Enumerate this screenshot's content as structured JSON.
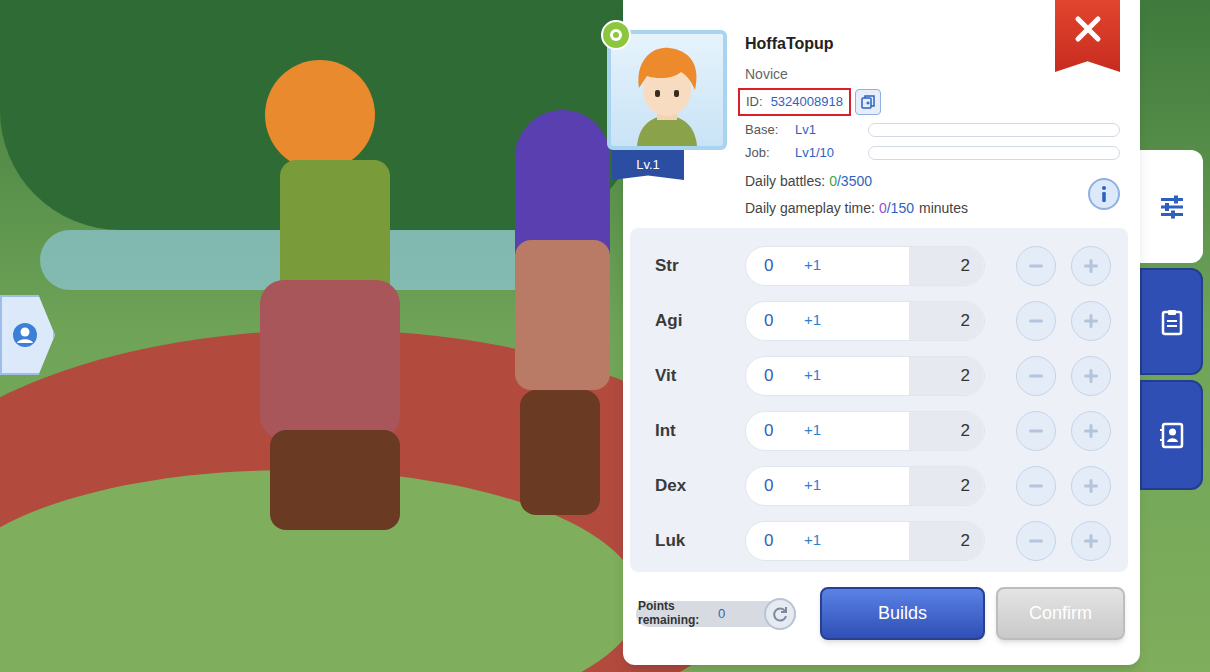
{
  "player": {
    "name": "HoffaTopup",
    "job_class": "Novice",
    "level_badge": "Lv.1",
    "id_label": "ID:",
    "id": "5324008918",
    "id_highlighted": true,
    "base_label": "Base:",
    "base_level": "Lv1",
    "base_exp_level": 0,
    "job_label": "Job:",
    "job_level": "Lv1/10",
    "job_exp_level": 0
  },
  "daily": [
    {
      "label": "Daily battles:",
      "value": "0",
      "total": "/3500",
      "suffix": "",
      "color": "#3aa845"
    },
    {
      "label": "Daily gameplay time:",
      "value": "0",
      "total": "/150",
      "suffix": "minutes",
      "color": "#9b4fd0"
    }
  ],
  "stats": [
    {
      "name": "Str",
      "value": "0",
      "bonus": "+1",
      "total": "2"
    },
    {
      "name": "Agi",
      "value": "0",
      "bonus": "+1",
      "total": "2"
    },
    {
      "name": "Vit",
      "value": "0",
      "bonus": "+1",
      "total": "2"
    },
    {
      "name": "Int",
      "value": "0",
      "bonus": "+1",
      "total": "2"
    },
    {
      "name": "Dex",
      "value": "0",
      "bonus": "+1",
      "total": "2"
    },
    {
      "name": "Luk",
      "value": "0",
      "bonus": "+1",
      "total": "2"
    }
  ],
  "points": {
    "label": "Points remaining:",
    "value": "0"
  },
  "buttons": [
    {
      "label": "Builds",
      "disabled": false
    },
    {
      "label": "Confirm",
      "disabled": true
    }
  ],
  "side_tabs": [
    {
      "selected": true
    },
    {
      "selected": false
    },
    {
      "selected": false
    }
  ]
}
